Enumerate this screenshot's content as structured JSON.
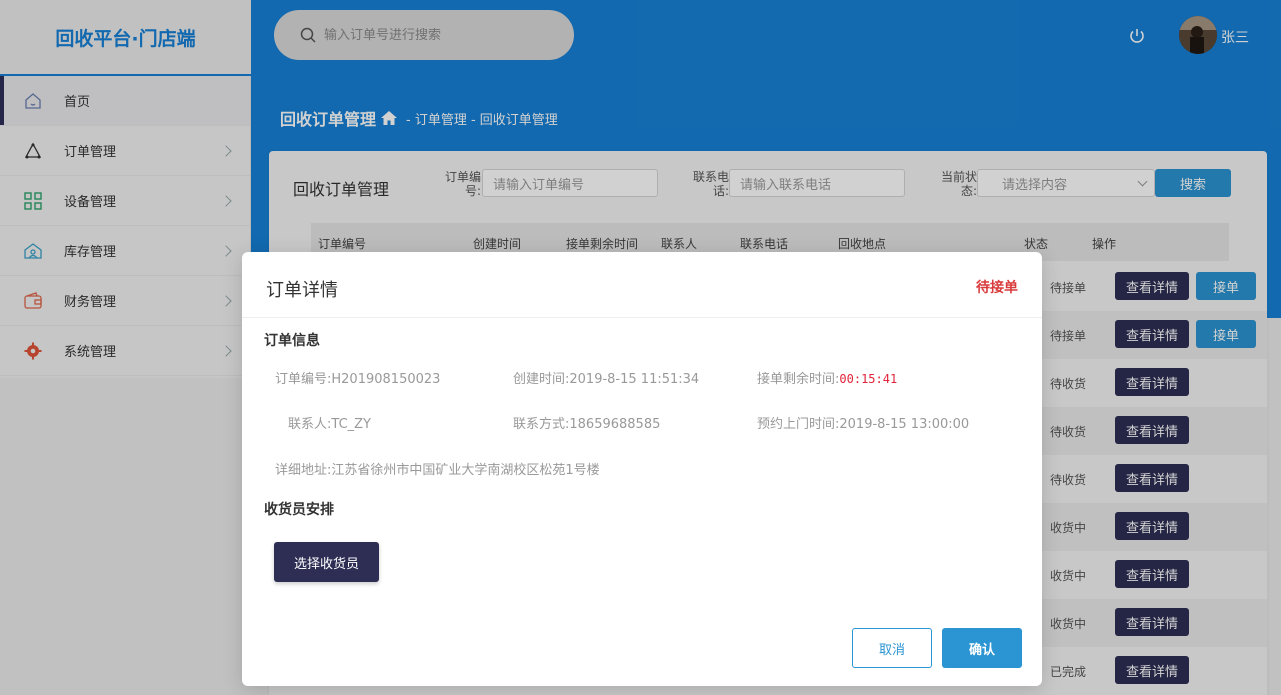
{
  "brand": {
    "title": "回收平台·门店端"
  },
  "header": {
    "search_placeholder": "输入订单号进行搜索",
    "username": "张三"
  },
  "sidebar": {
    "items": [
      {
        "label": "首页",
        "icon": "home-icon"
      },
      {
        "label": "订单管理",
        "icon": "order-icon"
      },
      {
        "label": "设备管理",
        "icon": "grid-icon"
      },
      {
        "label": "库存管理",
        "icon": "warehouse-icon"
      },
      {
        "label": "财务管理",
        "icon": "wallet-icon"
      },
      {
        "label": "系统管理",
        "icon": "gear-icon"
      }
    ]
  },
  "breadcrumb": {
    "main": "回收订单管理",
    "rest": "-  订单管理 -  回收订单管理"
  },
  "card": {
    "title": "回收订单管理",
    "filters": {
      "order_no_label": "订单编号:",
      "order_no_placeholder": "请输入订单编号",
      "phone_label": "联系电话:",
      "phone_placeholder": "请输入联系电话",
      "state_label": "当前状态:",
      "state_placeholder": "请选择内容",
      "search_label": "搜索"
    },
    "columns": [
      "订单编号",
      "创建时间",
      "接单剩余时间",
      "联系人",
      "联系电话",
      "回收地点",
      "状态",
      "操作"
    ],
    "rows": [
      {
        "status": "待接单",
        "detail": "查看详情",
        "accept": "接单"
      },
      {
        "status": "待接单",
        "detail": "查看详情",
        "accept": "接单"
      },
      {
        "status": "待收货",
        "detail": "查看详情"
      },
      {
        "status": "待收货",
        "detail": "查看详情"
      },
      {
        "status": "待收货",
        "detail": "查看详情"
      },
      {
        "status": "收货中",
        "detail": "查看详情"
      },
      {
        "status": "收货中",
        "detail": "查看详情"
      },
      {
        "status": "收货中",
        "detail": "查看详情"
      },
      {
        "status": "已完成",
        "detail": "查看详情"
      }
    ]
  },
  "modal": {
    "title": "订单详情",
    "state": "待接单",
    "section_info": "订单信息",
    "order_no_label": "订单编号:",
    "order_no": "H201908150023",
    "created_label": "创建时间:",
    "created": "2019-8-15 11:51:34",
    "remaining_label": "接单剩余时间:",
    "remaining": "00:15:41",
    "contact_label": "联系人:",
    "contact": "TC_ZY",
    "phone_label": "联系方式:",
    "phone": "18659688585",
    "visit_label": "预约上门时间:",
    "visit": "2019-8-15 13:00:00",
    "address_label": "详细地址:",
    "address": "江苏省徐州市中国矿业大学南湖校区松苑1号楼",
    "section_collector": "收货员安排",
    "pick_label": "选择收货员",
    "cancel_label": "取消",
    "ok_label": "确认"
  },
  "colors": {
    "primary_blue": "#1781d6",
    "dark_button": "#2e2e55",
    "accent_blue": "#2b94d2",
    "state_red": "#d93c3c"
  }
}
